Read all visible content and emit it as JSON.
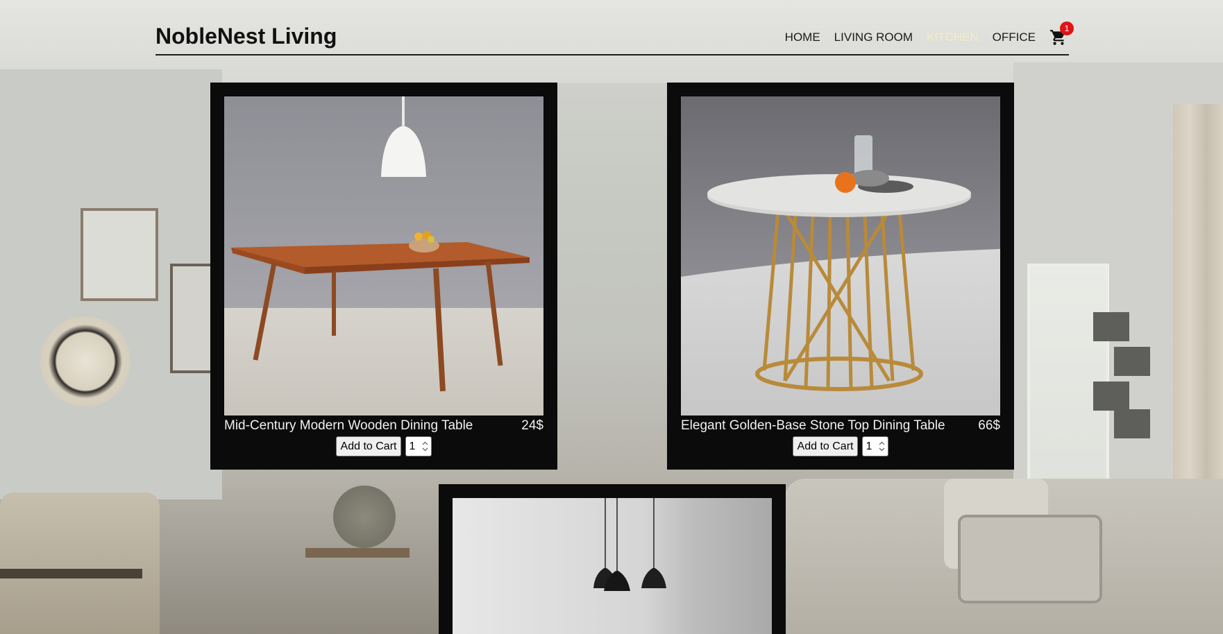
{
  "site": {
    "logo": "NobleNest Living"
  },
  "nav": {
    "items": [
      {
        "label": "HOME",
        "active": false
      },
      {
        "label": "LIVING ROOM",
        "active": false
      },
      {
        "label": "KITCHEN",
        "active": true
      },
      {
        "label": "OFFICE",
        "active": false
      }
    ],
    "cart_icon": "shopping-cart-icon",
    "cart_count": "1",
    "active_color": "#f3ecc3",
    "badge_color": "#e01414"
  },
  "products": [
    {
      "name": "Mid-Century Modern Wooden Dining Table",
      "price": "24$",
      "add_label": "Add to Cart",
      "quantity": "1"
    },
    {
      "name": "Elegant Golden-Base Stone Top Dining Table",
      "price": "66$",
      "add_label": "Add to Cart",
      "quantity": "1"
    },
    {
      "name": "",
      "price": "",
      "add_label": "",
      "quantity": ""
    }
  ]
}
